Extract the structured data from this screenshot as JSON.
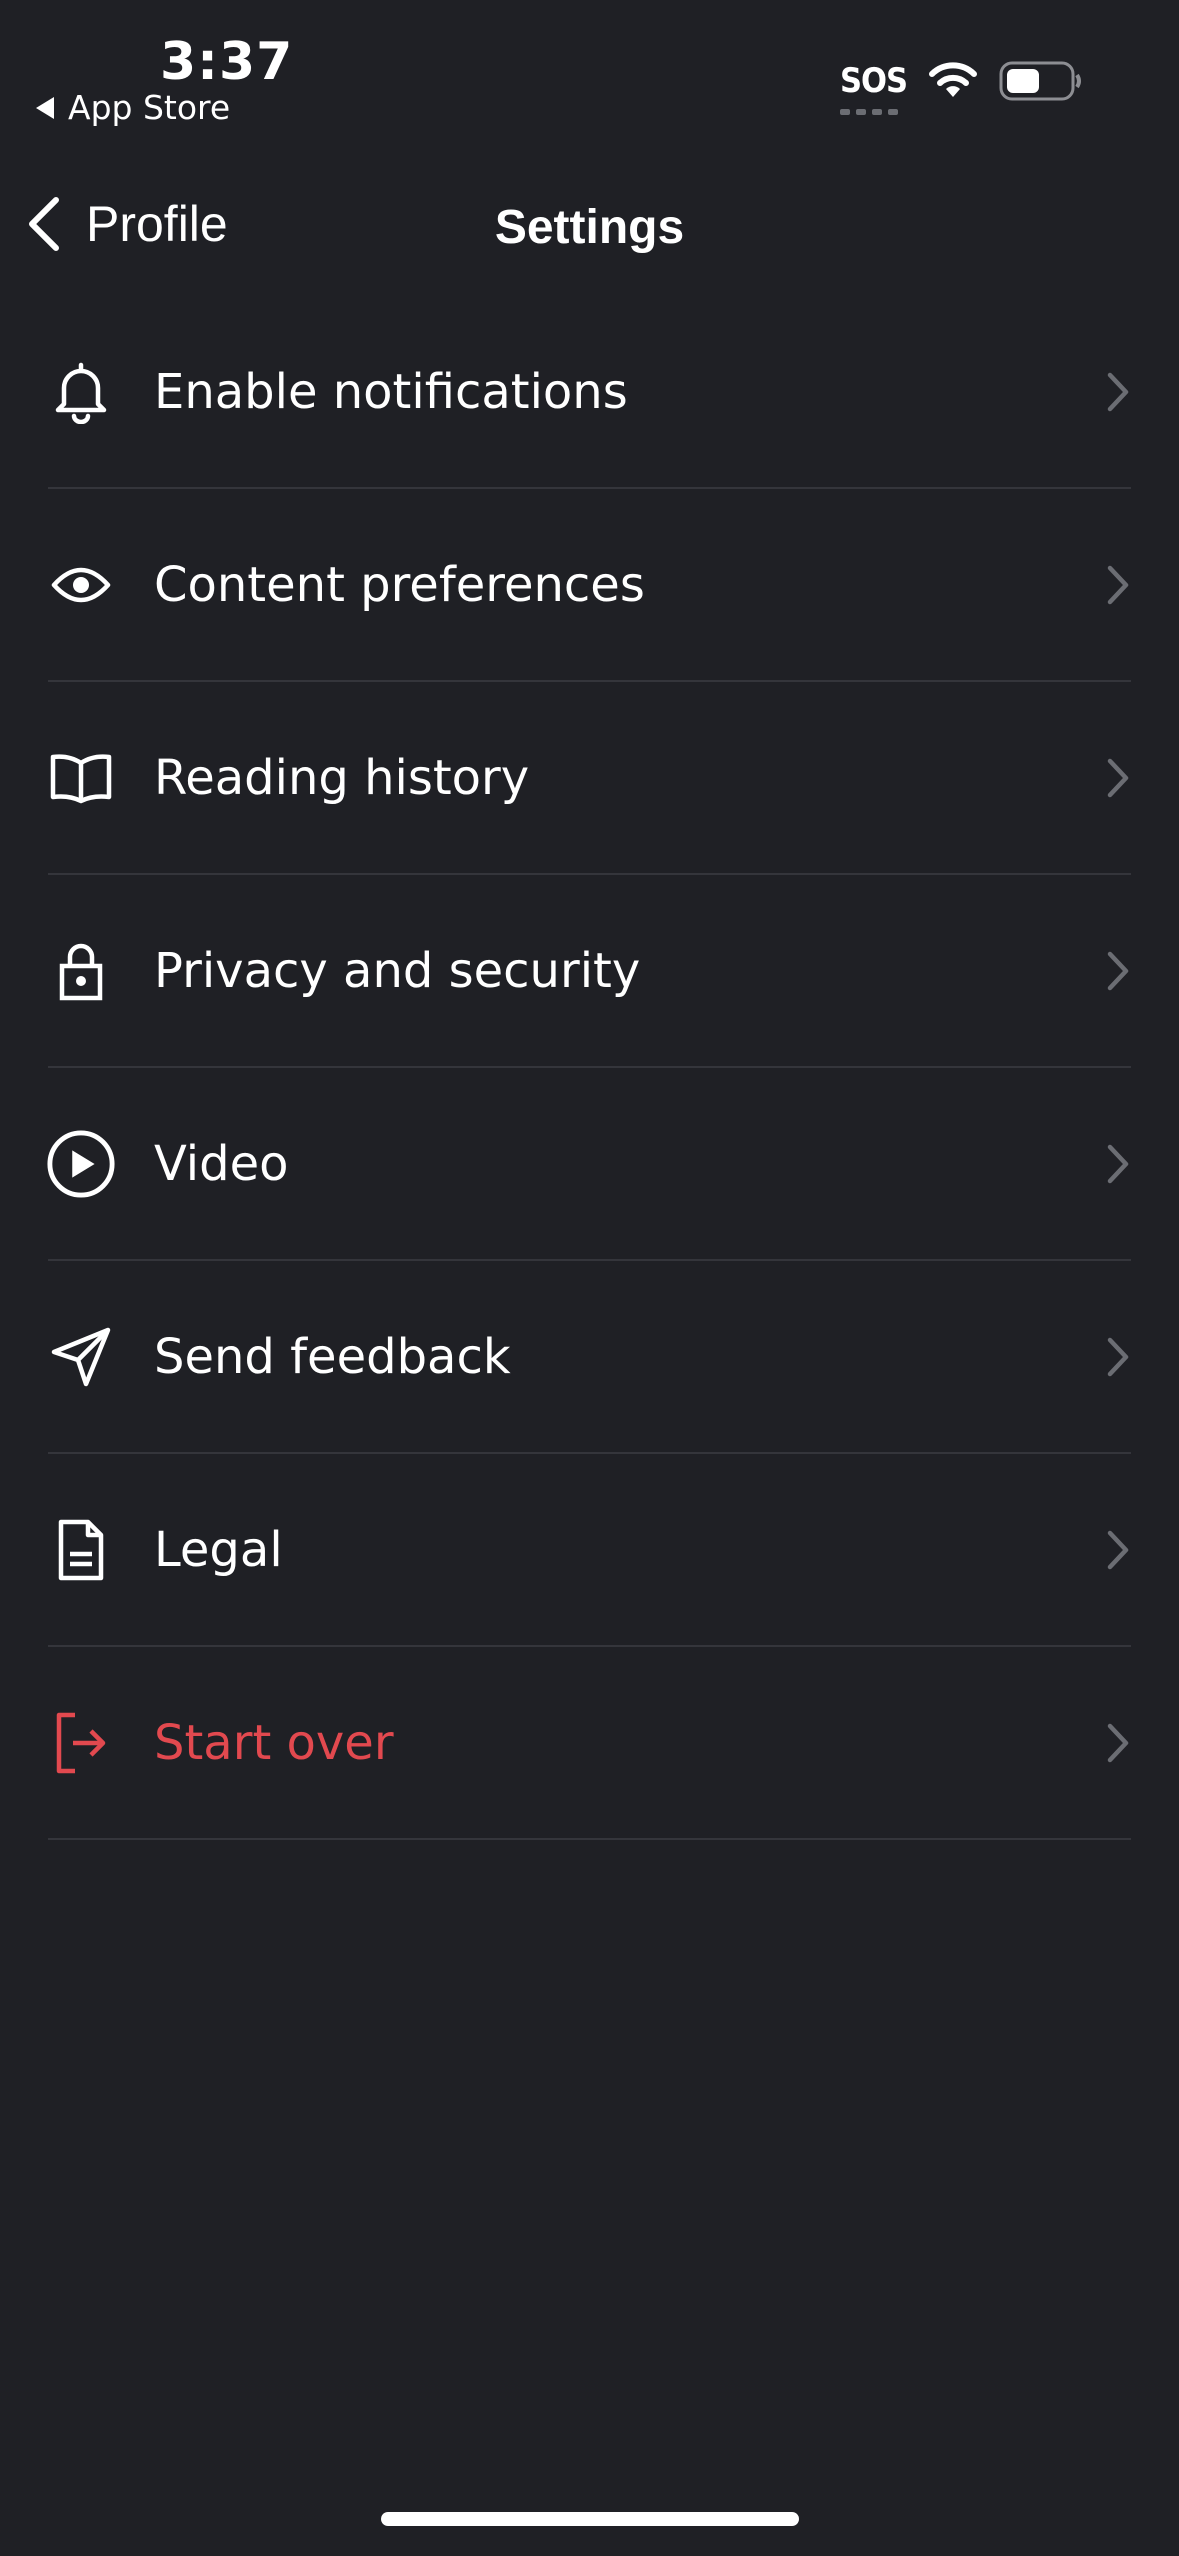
{
  "status_bar": {
    "time": "3:37",
    "back_app": "App Store",
    "sos": "SOS"
  },
  "nav": {
    "back_label": "Profile",
    "title": "Settings"
  },
  "menu": {
    "items": [
      {
        "label": "Enable notifications",
        "icon": "bell-icon"
      },
      {
        "label": "Content preferences",
        "icon": "eye-icon"
      },
      {
        "label": "Reading history",
        "icon": "book-icon"
      },
      {
        "label": "Privacy and security",
        "icon": "lock-icon"
      },
      {
        "label": "Video",
        "icon": "play-circle-icon"
      },
      {
        "label": "Send feedback",
        "icon": "send-icon"
      },
      {
        "label": "Legal",
        "icon": "document-icon"
      },
      {
        "label": "Start over",
        "icon": "log-out-icon"
      }
    ]
  },
  "colors": {
    "background": "#1f2025",
    "divider": "#34353b",
    "danger": "#e2494f",
    "chevron": "#6b6d73"
  }
}
